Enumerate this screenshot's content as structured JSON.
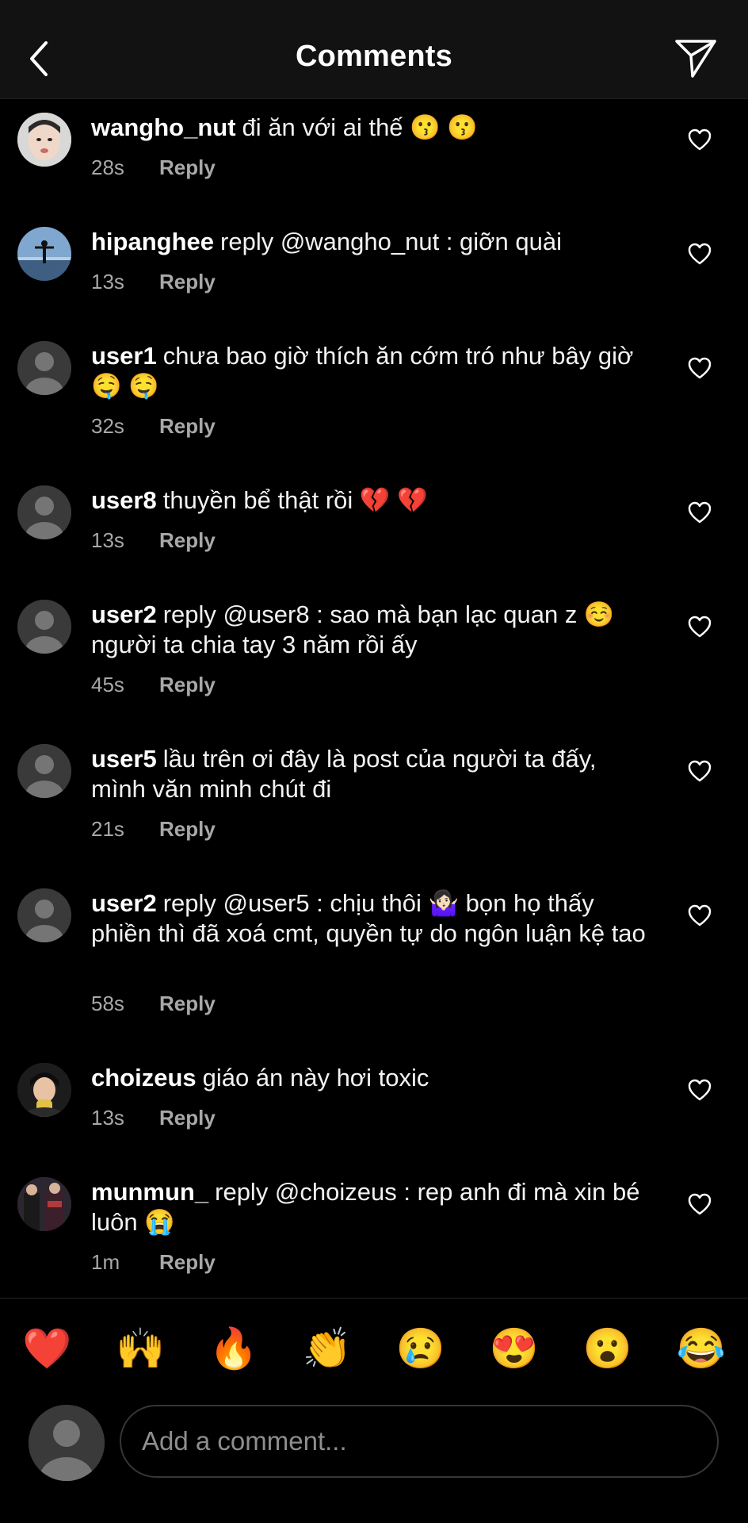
{
  "header": {
    "title": "Comments"
  },
  "comments": [
    {
      "user": "wangho_nut",
      "text": "đi ăn với ai thế 😗 😗",
      "time": "28s",
      "reply": "Reply"
    },
    {
      "user": "hipanghee",
      "text": "reply @wangho_nut : giỡn quài",
      "time": "13s",
      "reply": "Reply"
    },
    {
      "user": "user1",
      "text": "chưa bao giờ thích ăn cớm tró như bây giờ 🤤 🤤",
      "time": "32s",
      "reply": "Reply"
    },
    {
      "user": "user8",
      "text": "thuyền bể thật rồi 💔 💔",
      "time": "13s",
      "reply": "Reply"
    },
    {
      "user": "user2",
      "text": "reply @user8 : sao mà bạn lạc quan z ☺️ người ta chia tay 3 năm rồi ấy",
      "time": "45s",
      "reply": "Reply"
    },
    {
      "user": "user5",
      "text": "lầu trên ơi đây là post của người ta đấy, mình văn minh chút đi",
      "time": "21s",
      "reply": "Reply"
    },
    {
      "user": "user2",
      "text": "reply @user5 : chịu thôi 🤷🏻‍♀️ bọn họ thấy phiền thì đã xoá cmt, quyền tự do ngôn luận kệ tao",
      "time": "58s",
      "reply": "Reply"
    },
    {
      "user": "choizeus",
      "text": "giáo án này hơi toxic",
      "time": "13s",
      "reply": "Reply"
    },
    {
      "user": "munmun_",
      "text": "reply @choizeus : rep anh đi mà xin bé luôn 😭",
      "time": "1m",
      "reply": "Reply"
    }
  ],
  "emoji_bar": [
    "❤️",
    "🙌",
    "🔥",
    "👏",
    "😢",
    "😍",
    "😮",
    "😂"
  ],
  "composer": {
    "placeholder": "Add a comment..."
  },
  "colors": {
    "background": "#000000",
    "header": "#121212",
    "muted": "#a8a8a8"
  }
}
